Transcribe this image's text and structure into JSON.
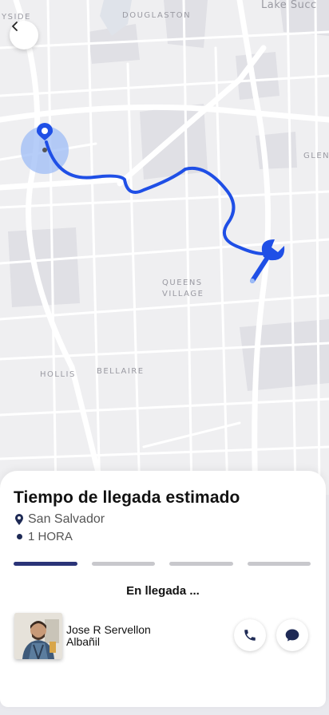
{
  "map": {
    "labels": [
      "YSIDE",
      "DOUGLASTON",
      "Lake Succ",
      "GLEN",
      "QUEENS",
      "VILLAGE",
      "HOLLIS",
      "BELLAIRE"
    ]
  },
  "header": {
    "back_icon": "chevron-left-icon"
  },
  "sheet": {
    "title": "Tiempo de llegada estimado",
    "location": "San Salvador",
    "location_icon": "map-pin-icon",
    "eta": "1 HORA",
    "progress": {
      "total_steps": 4,
      "current_step": 1
    },
    "status": "En llegada ...",
    "worker": {
      "name": "Jose R Servellon",
      "role": "Albañil"
    },
    "actions": {
      "call_icon": "phone-icon",
      "chat_icon": "chat-bubble-icon"
    }
  },
  "colors": {
    "route": "#1f4fe6",
    "progress_active": "#2a3478",
    "progress_inactive": "#c8c8cc"
  }
}
